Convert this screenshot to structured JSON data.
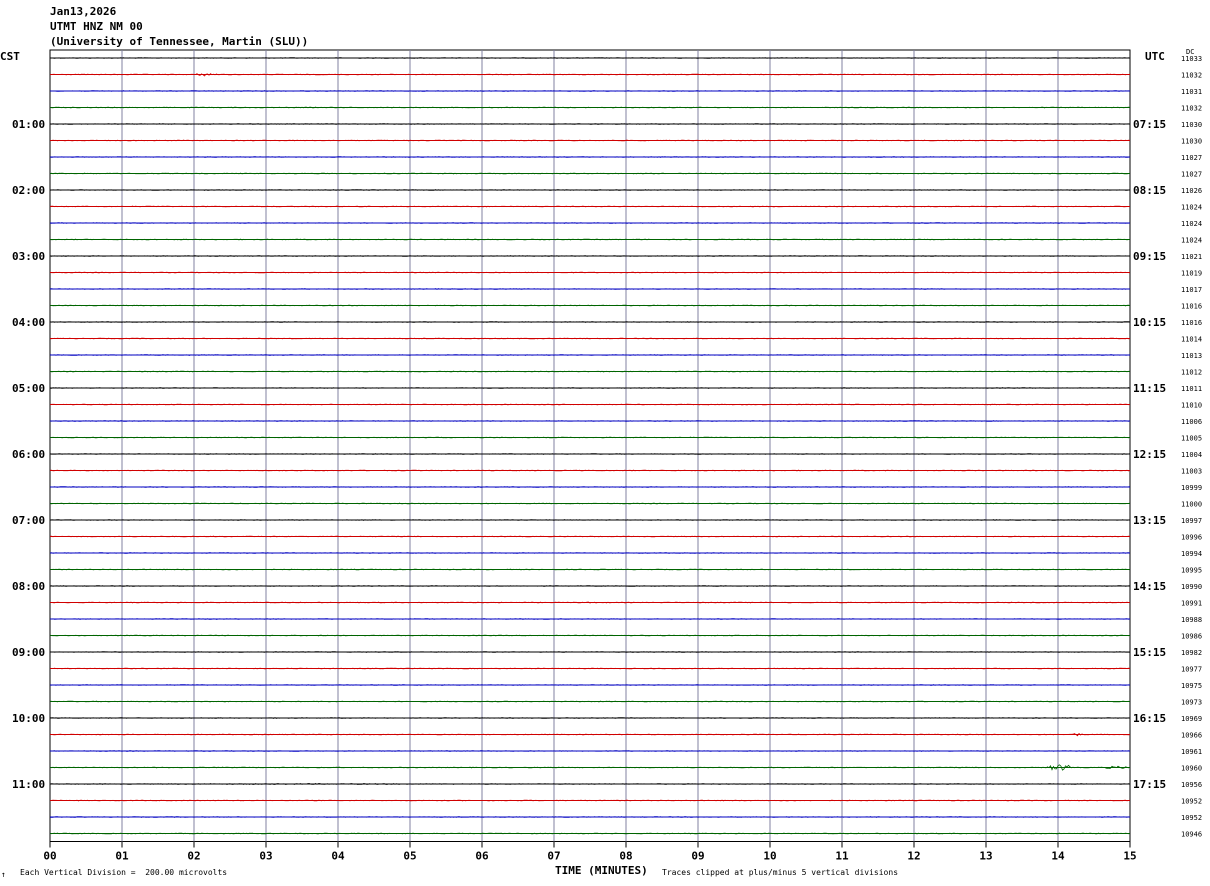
{
  "header": {
    "date": "Jan13,2026",
    "station": "UTMT HNZ NM 00",
    "network": "(University of Tennessee, Martin (SLU))"
  },
  "left_tz": "CST",
  "right_tz": "UTC",
  "dc_label": "DC",
  "footer": {
    "scale": "Each Vertical Division =  200.00 microvolts",
    "clip": "Traces clipped at plus/minus 5 vertical divisions",
    "mark": "↑"
  },
  "colors": {
    "black": "#000000",
    "red": "#d00000",
    "blue": "#0000c0",
    "green": "#006400",
    "grid": "#8080a0"
  },
  "chart_data": {
    "type": "line",
    "xlabel": "TIME (MINUTES)",
    "x_ticks": [
      "00",
      "01",
      "02",
      "03",
      "04",
      "05",
      "06",
      "07",
      "08",
      "09",
      "10",
      "11",
      "12",
      "13",
      "14",
      "15"
    ],
    "xlim": [
      0,
      15
    ],
    "trace_colors": [
      "black",
      "red",
      "blue",
      "green"
    ],
    "row_labels_left": [
      "01:00",
      "02:00",
      "03:00",
      "04:00",
      "05:00",
      "06:00",
      "07:00",
      "08:00",
      "09:00",
      "10:00",
      "11:00"
    ],
    "row_labels_right": [
      "07:15",
      "08:15",
      "09:15",
      "10:15",
      "11:15",
      "12:15",
      "13:15",
      "14:15",
      "15:15",
      "16:15",
      "17:15"
    ],
    "dc_offsets": [
      11033,
      11032,
      11031,
      11032,
      11030,
      11030,
      11027,
      11027,
      11026,
      11024,
      11024,
      11024,
      11021,
      11019,
      11017,
      11016,
      11016,
      11014,
      11013,
      11012,
      11011,
      11010,
      11006,
      11005,
      11004,
      11003,
      10999,
      11000,
      10997,
      10996,
      10994,
      10995,
      10990,
      10991,
      10988,
      10986,
      10982,
      10977,
      10975,
      10973,
      10969,
      10966,
      10961,
      10960,
      10956,
      10952,
      10952,
      10946
    ],
    "events": [
      {
        "trace": 1,
        "start_min": 2.0,
        "end_min": 2.35,
        "amp_div": 0.45
      },
      {
        "trace": 2,
        "start_min": 5.65,
        "end_min": 6.2,
        "amp_div": 0.1
      },
      {
        "trace": 33,
        "start_min": 7.4,
        "end_min": 7.8,
        "amp_div": 0.2
      },
      {
        "trace": 41,
        "start_min": 14.15,
        "end_min": 14.35,
        "amp_div": 0.45
      },
      {
        "trace": 43,
        "start_min": 13.85,
        "end_min": 14.2,
        "amp_div": 1.0
      },
      {
        "trace": 43,
        "start_min": 14.6,
        "end_min": 15.0,
        "amp_div": 0.4
      },
      {
        "trace": 44,
        "start_min": 0.0,
        "end_min": 7.0,
        "amp_div": 0.15
      }
    ]
  }
}
